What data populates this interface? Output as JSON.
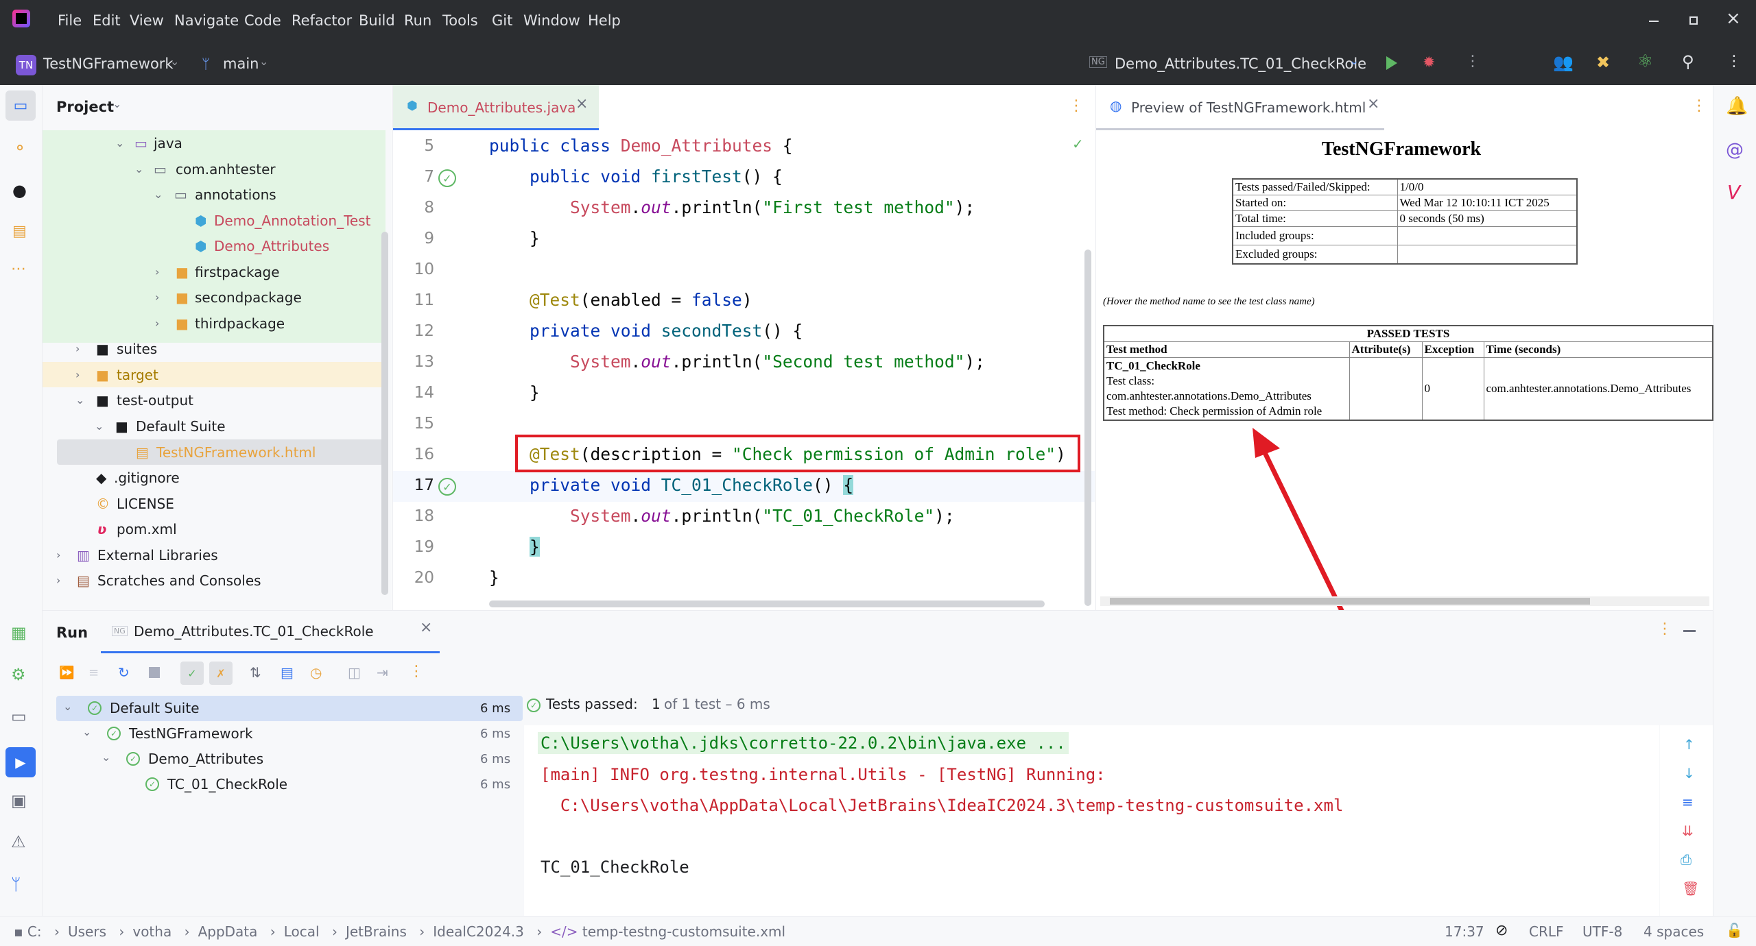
{
  "menu": [
    "File",
    "Edit",
    "View",
    "Navigate",
    "Code",
    "Refactor",
    "Build",
    "Run",
    "Tools",
    "Git",
    "Window",
    "Help"
  ],
  "project": {
    "initials": "TN",
    "name": "TestNGFramework",
    "branch": "main"
  },
  "run_config": "Demo_Attributes.TC_01_CheckRole",
  "project_panel": {
    "title": "Project",
    "items": [
      "java",
      "com.anhtester",
      "annotations",
      "Demo_Annotation_Test",
      "Demo_Attributes",
      "firstpackage",
      "secondpackage",
      "thirdpackage",
      "suites",
      "target",
      "test-output",
      "Default Suite",
      "TestNGFramework.html",
      ".gitignore",
      "LICENSE",
      "pom.xml",
      "External Libraries",
      "Scratches and Consoles"
    ]
  },
  "editor": {
    "tab": "Demo_Attributes.java",
    "line_numbers": [
      "5",
      "7",
      "8",
      "9",
      "10",
      "11",
      "12",
      "13",
      "14",
      "15",
      "16",
      "17",
      "18",
      "19",
      "20"
    ]
  },
  "preview": {
    "tab": "Preview of TestNGFramework.html",
    "title": "TestNGFramework",
    "summary": [
      [
        "Tests passed/Failed/Skipped:",
        "1/0/0"
      ],
      [
        "Started on:",
        "Wed Mar 12 10:10:11 ICT 2025"
      ],
      [
        "Total time:",
        "0 seconds (50 ms)"
      ],
      [
        "Included groups:",
        ""
      ],
      [
        "Excluded groups:",
        ""
      ]
    ],
    "hint": "(Hover the method name to see the test class name)",
    "passed_header": "PASSED TESTS",
    "columns": [
      "Test method",
      "Attribute(s)",
      "Exception",
      "Time (seconds)"
    ],
    "row": {
      "method": "TC_01_CheckRole",
      "class_label": "Test class:",
      "class_name": "com.anhtester.annotations.Demo_Attributes",
      "method_label": "Test method: Check permission of Admin role",
      "attributes": "",
      "exception": "0",
      "time": "com.anhtester.annotations.Demo_Attributes"
    }
  },
  "run_panel": {
    "title": "Run",
    "tab": "Demo_Attributes.TC_01_CheckRole",
    "tree": [
      {
        "label": "Default Suite",
        "time": "6 ms"
      },
      {
        "label": "TestNGFramework",
        "time": "6 ms"
      },
      {
        "label": "Demo_Attributes",
        "time": "6 ms"
      },
      {
        "label": "TC_01_CheckRole",
        "time": "6 ms"
      }
    ],
    "status_prefix": "Tests passed:",
    "status_count": "1",
    "status_suffix": "of 1 test – 6 ms",
    "console": [
      "C:\\Users\\votha\\.jdks\\corretto-22.0.2\\bin\\java.exe ...",
      "[main] INFO org.testng.internal.Utils - [TestNG] Running:",
      "  C:\\Users\\votha\\AppData\\Local\\JetBrains\\IdeaIC2024.3\\temp-testng-customsuite.xml",
      "",
      "TC_01_CheckRole"
    ]
  },
  "breadcrumb": [
    "C:",
    "Users",
    "votha",
    "AppData",
    "Local",
    "JetBrains",
    "IdealC2024.3",
    "temp-testng-customsuite.xml"
  ],
  "status": {
    "position": "17:37",
    "line_sep": "CRLF",
    "encoding": "UTF-8",
    "indent": "4 spaces"
  },
  "colors": {
    "highlight_box": "#e01b24",
    "arrow": "#e01b24",
    "pass": "#499c54"
  }
}
